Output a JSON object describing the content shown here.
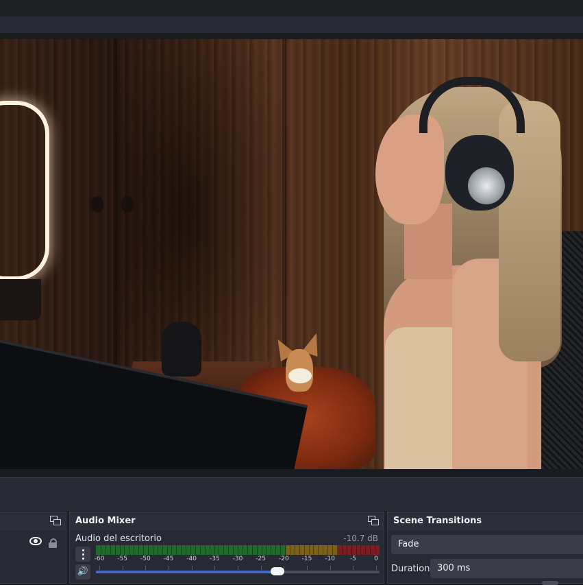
{
  "preview": {
    "description_icon": "camera-preview"
  },
  "mixer": {
    "title": "Audio Mixer",
    "source_name": "Audio del escritorio",
    "level": "-10.7 dB",
    "scale_labels": [
      "-60",
      "-55",
      "-50",
      "-45",
      "-40",
      "-35",
      "-30",
      "-25",
      "-20",
      "-15",
      "-10",
      "-5",
      "0"
    ],
    "volume_fraction": 0.64
  },
  "transitions": {
    "title": "Scene Transitions",
    "selected": "Fade",
    "duration_label": "Duration",
    "duration_value": "300 ms"
  },
  "colors": {
    "meter_green": "#1f6b2a",
    "meter_yellow": "#7d6019",
    "meter_red": "#7b1d23",
    "slider_fill": "#4a69d0"
  }
}
